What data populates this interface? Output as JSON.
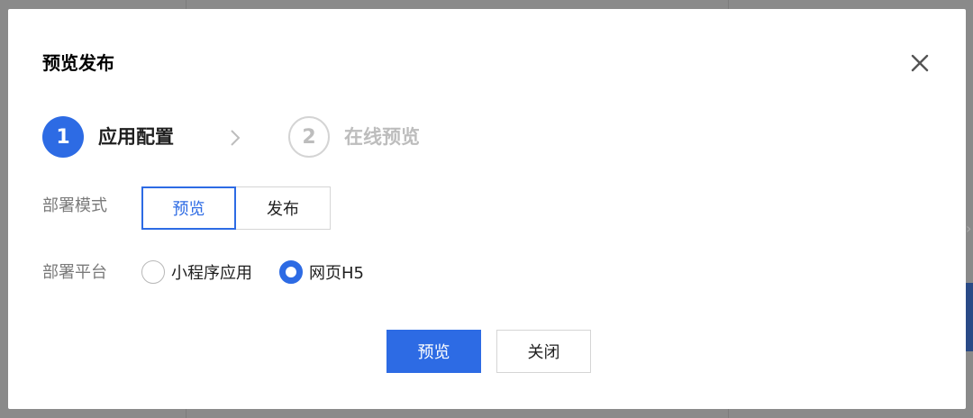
{
  "dialog": {
    "title": "预览发布",
    "close_icon": "close-icon"
  },
  "steps": [
    {
      "number": "1",
      "label": "应用配置",
      "state": "active"
    },
    {
      "number": "2",
      "label": "在线预览",
      "state": "inactive"
    }
  ],
  "deploy_mode": {
    "label": "部署模式",
    "options": [
      "预览",
      "发布"
    ],
    "selected": "预览"
  },
  "deploy_platform": {
    "label": "部署平台",
    "options": [
      "小程序应用",
      "网页H5"
    ],
    "selected": "网页H5"
  },
  "footer": {
    "primary_label": "预览",
    "close_label": "关闭"
  },
  "colors": {
    "accent": "#2d6be4",
    "overlay": "#8a8a8a",
    "inactive": "#bdbdbd"
  }
}
